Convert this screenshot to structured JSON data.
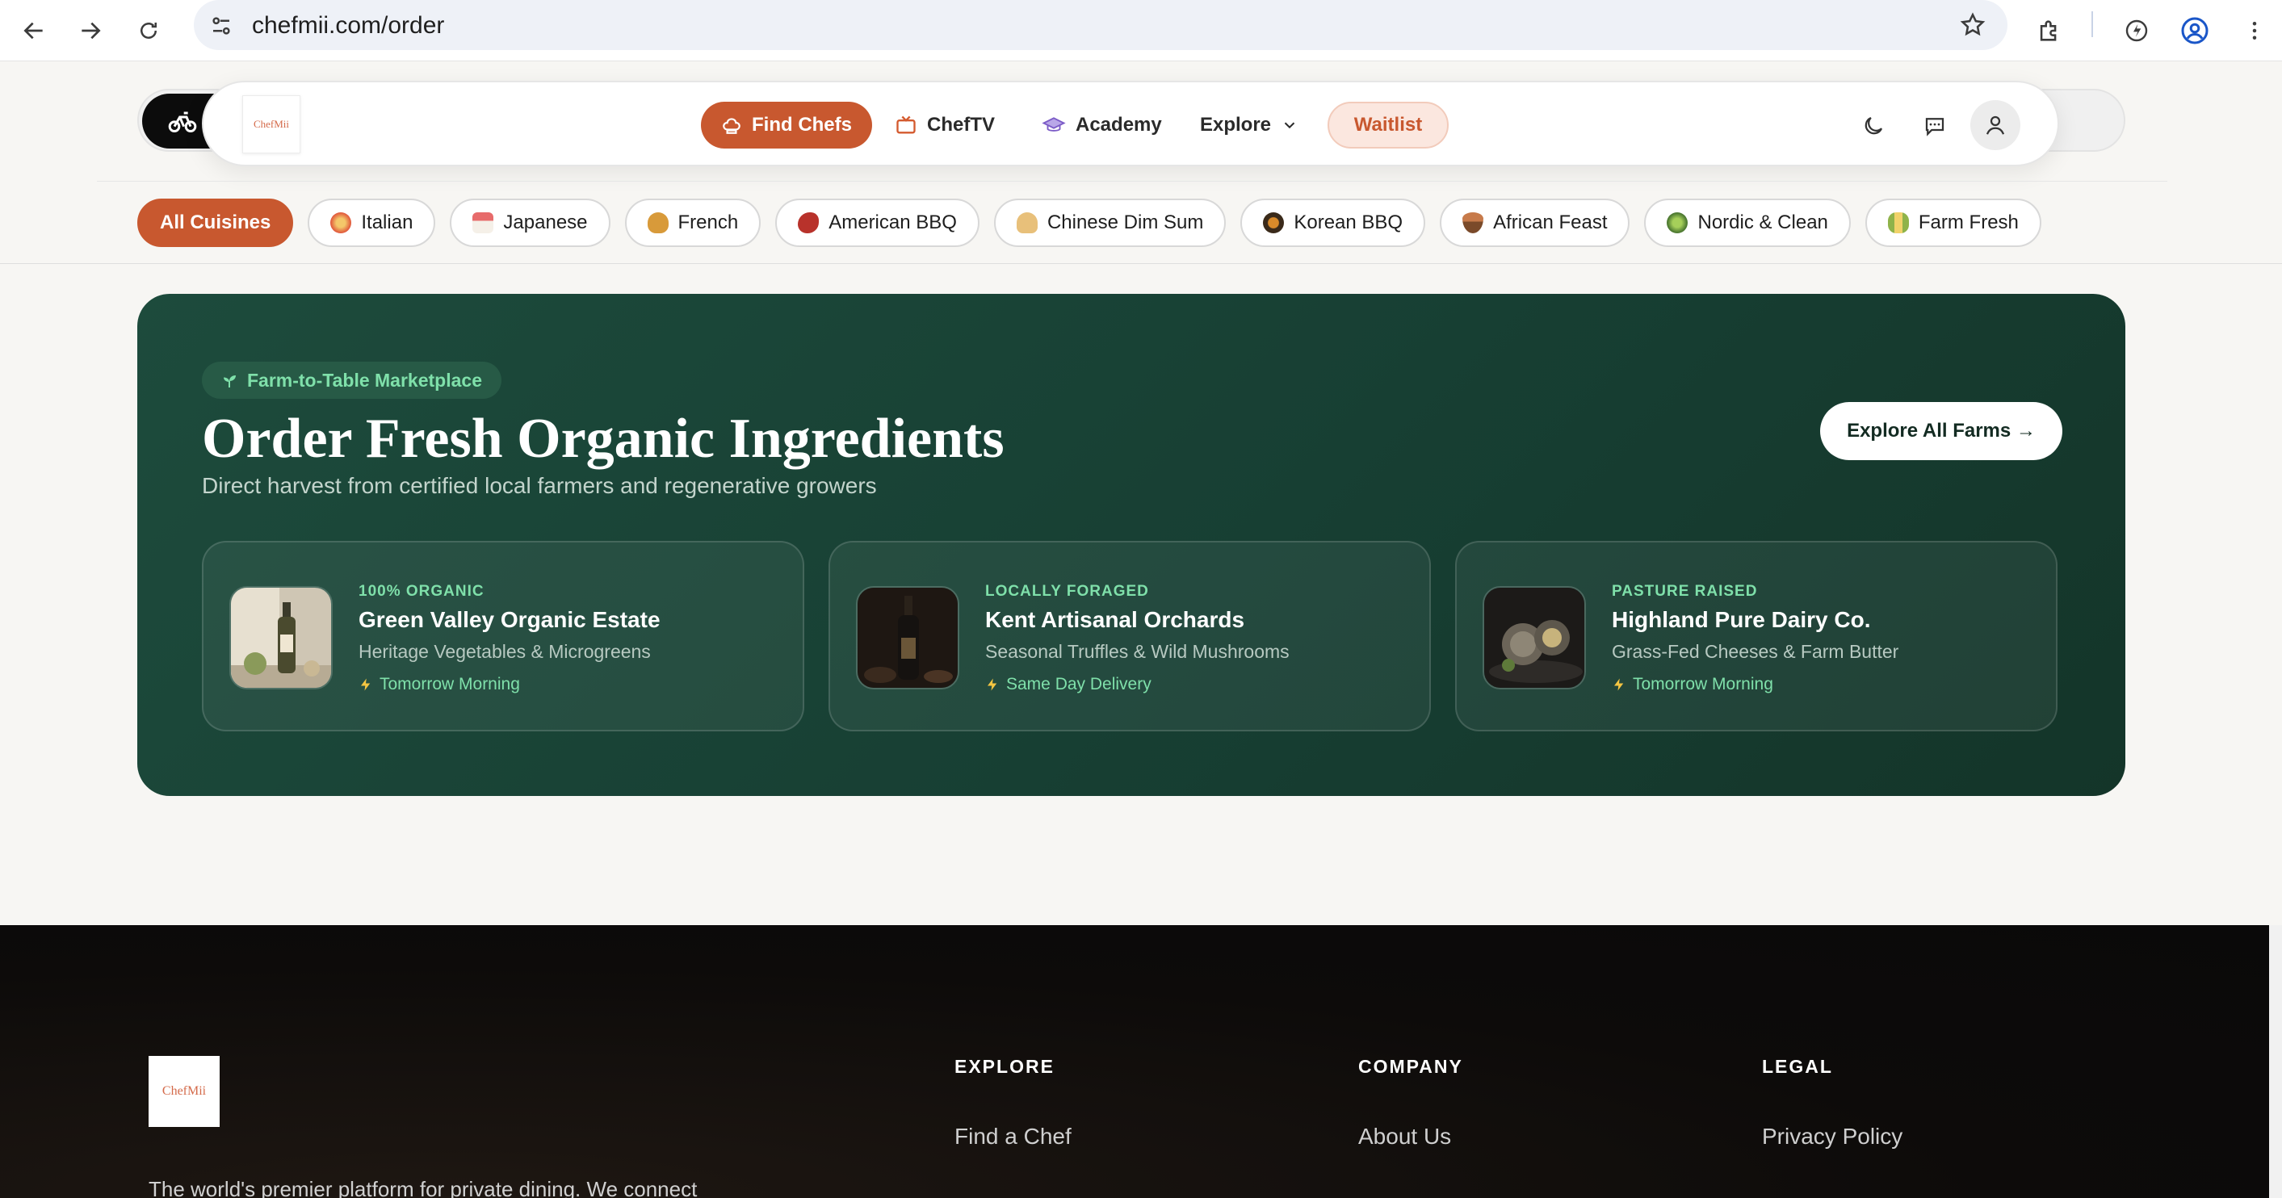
{
  "browser": {
    "url": "chefmii.com/order"
  },
  "header": {
    "logo_text": "ChefMii",
    "nav": {
      "find_chefs": "Find Chefs",
      "cheftv": "ChefTV",
      "academy": "Academy",
      "explore": "Explore",
      "waitlist": "Waitlist"
    }
  },
  "cuisines": [
    {
      "label": "All Cuisines",
      "active": true
    },
    {
      "label": "Italian",
      "color": "#e0553a"
    },
    {
      "label": "Japanese",
      "color": "#e76b6b"
    },
    {
      "label": "French",
      "color": "#d89a3a"
    },
    {
      "label": "American BBQ",
      "color": "#b8322b"
    },
    {
      "label": "Chinese Dim Sum",
      "color": "#e8c07a"
    },
    {
      "label": "Korean BBQ",
      "color": "#3a2a1a"
    },
    {
      "label": "African Feast",
      "color": "#c77a4a"
    },
    {
      "label": "Nordic & Clean",
      "color": "#5a8a3a"
    },
    {
      "label": "Farm Fresh",
      "color": "#8fb34a"
    }
  ],
  "hero": {
    "tag": "Farm-to-Table Marketplace",
    "title": "Order Fresh Organic Ingredients",
    "subtitle": "Direct harvest from certified local farmers and regenerative growers",
    "cta": "Explore All Farms →"
  },
  "farms": [
    {
      "tag": "100% ORGANIC",
      "name": "Green Valley Organic Estate",
      "desc": "Heritage Vegetables & Microgreens",
      "delivery": "Tomorrow Morning"
    },
    {
      "tag": "LOCALLY FORAGED",
      "name": "Kent Artisanal Orchards",
      "desc": "Seasonal Truffles & Wild Mushrooms",
      "delivery": "Same Day Delivery"
    },
    {
      "tag": "PASTURE RAISED",
      "name": "Highland Pure Dairy Co.",
      "desc": "Grass-Fed Cheeses & Farm Butter",
      "delivery": "Tomorrow Morning"
    }
  ],
  "footer": {
    "logo_text": "ChefMii",
    "description": "The world's premier platform for private dining. We connect",
    "columns": [
      {
        "title": "EXPLORE",
        "link": "Find a Chef"
      },
      {
        "title": "COMPANY",
        "link": "About Us"
      },
      {
        "title": "LEGAL",
        "link": "Privacy Policy"
      }
    ]
  },
  "colors": {
    "accent": "#c8582f",
    "hero_green": "#1a4538",
    "mint": "#7fe0aa"
  }
}
